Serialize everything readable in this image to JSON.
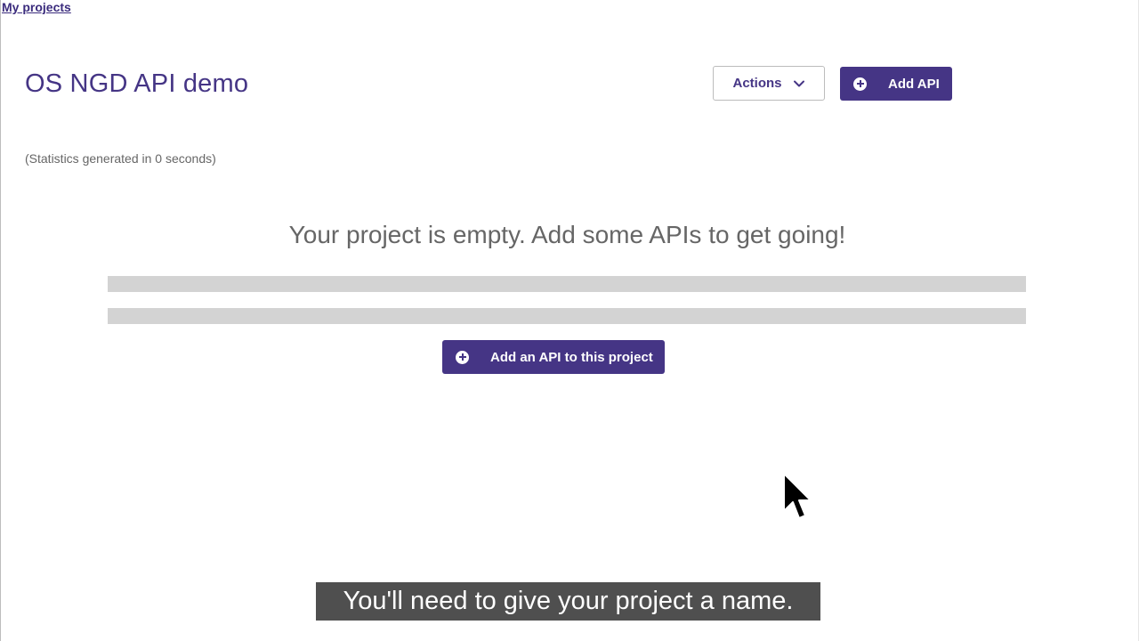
{
  "breadcrumb": {
    "my_projects": "My projects"
  },
  "project": {
    "title": "OS NGD API demo",
    "stats": "(Statistics generated in 0 seconds)",
    "empty_message": "Your project is empty. Add some APIs to get going!"
  },
  "toolbar": {
    "actions_label": "Actions",
    "add_api_label": "Add API"
  },
  "empty_state": {
    "add_button_label": "Add an API to this project"
  },
  "caption": {
    "text": "You'll need to give your project a name."
  },
  "icons": {
    "plus": "plus-circle-icon",
    "chevron": "chevron-down-icon",
    "cursor": "mouse-pointer-icon"
  },
  "colors": {
    "brand": "#453585",
    "muted_text": "#666666",
    "placeholder_bar": "#d3d3d3"
  }
}
